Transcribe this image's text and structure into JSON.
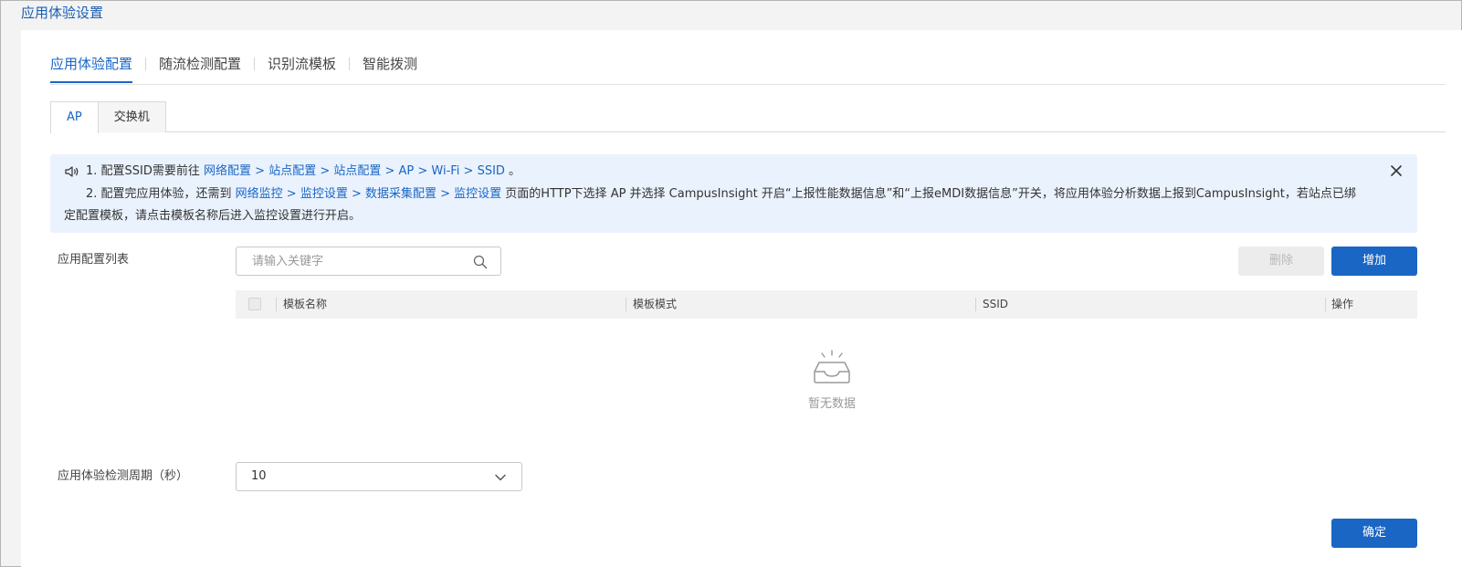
{
  "page": {
    "title": "应用体验设置"
  },
  "main_tabs": [
    {
      "label": "应用体验配置",
      "active": true
    },
    {
      "label": "随流检测配置",
      "active": false
    },
    {
      "label": "识别流模板",
      "active": false
    },
    {
      "label": "智能拨测",
      "active": false
    }
  ],
  "sub_tabs": [
    {
      "label": "AP",
      "active": true
    },
    {
      "label": "交换机",
      "active": false
    }
  ],
  "notice": {
    "line1": {
      "prefix": "1. 配置SSID需要前往 ",
      "link": "网络配置 > 站点配置 > 站点配置 > AP > Wi-Fi > SSID",
      "suffix": " 。"
    },
    "line2": {
      "prefix": "2. 配置完应用体验，还需到 ",
      "link": "网络监控 > 监控设置 > 数据采集配置 > 监控设置",
      "suffix": " 页面的HTTP下选择 AP 并选择 CampusInsight 开启“上报性能数据信息”和“上报eMDI数据信息”开关，将应用体验分析数据上报到CampusInsight，若站点已绑"
    },
    "line3": "定配置模板，请点击模板名称后进入监控设置进行开启。"
  },
  "list": {
    "label": "应用配置列表",
    "search_placeholder": "请输入关键字",
    "delete_label": "删除",
    "add_label": "增加",
    "columns": [
      "模板名称",
      "模板模式",
      "SSID",
      "操作"
    ],
    "rows": [],
    "empty_text": "暂无数据"
  },
  "period": {
    "label": "应用体验检测周期（秒）",
    "value": "10"
  },
  "footer": {
    "ok_label": "确定"
  },
  "colors": {
    "primary": "#1a66c4",
    "notice_bg": "#eaf2fd"
  }
}
